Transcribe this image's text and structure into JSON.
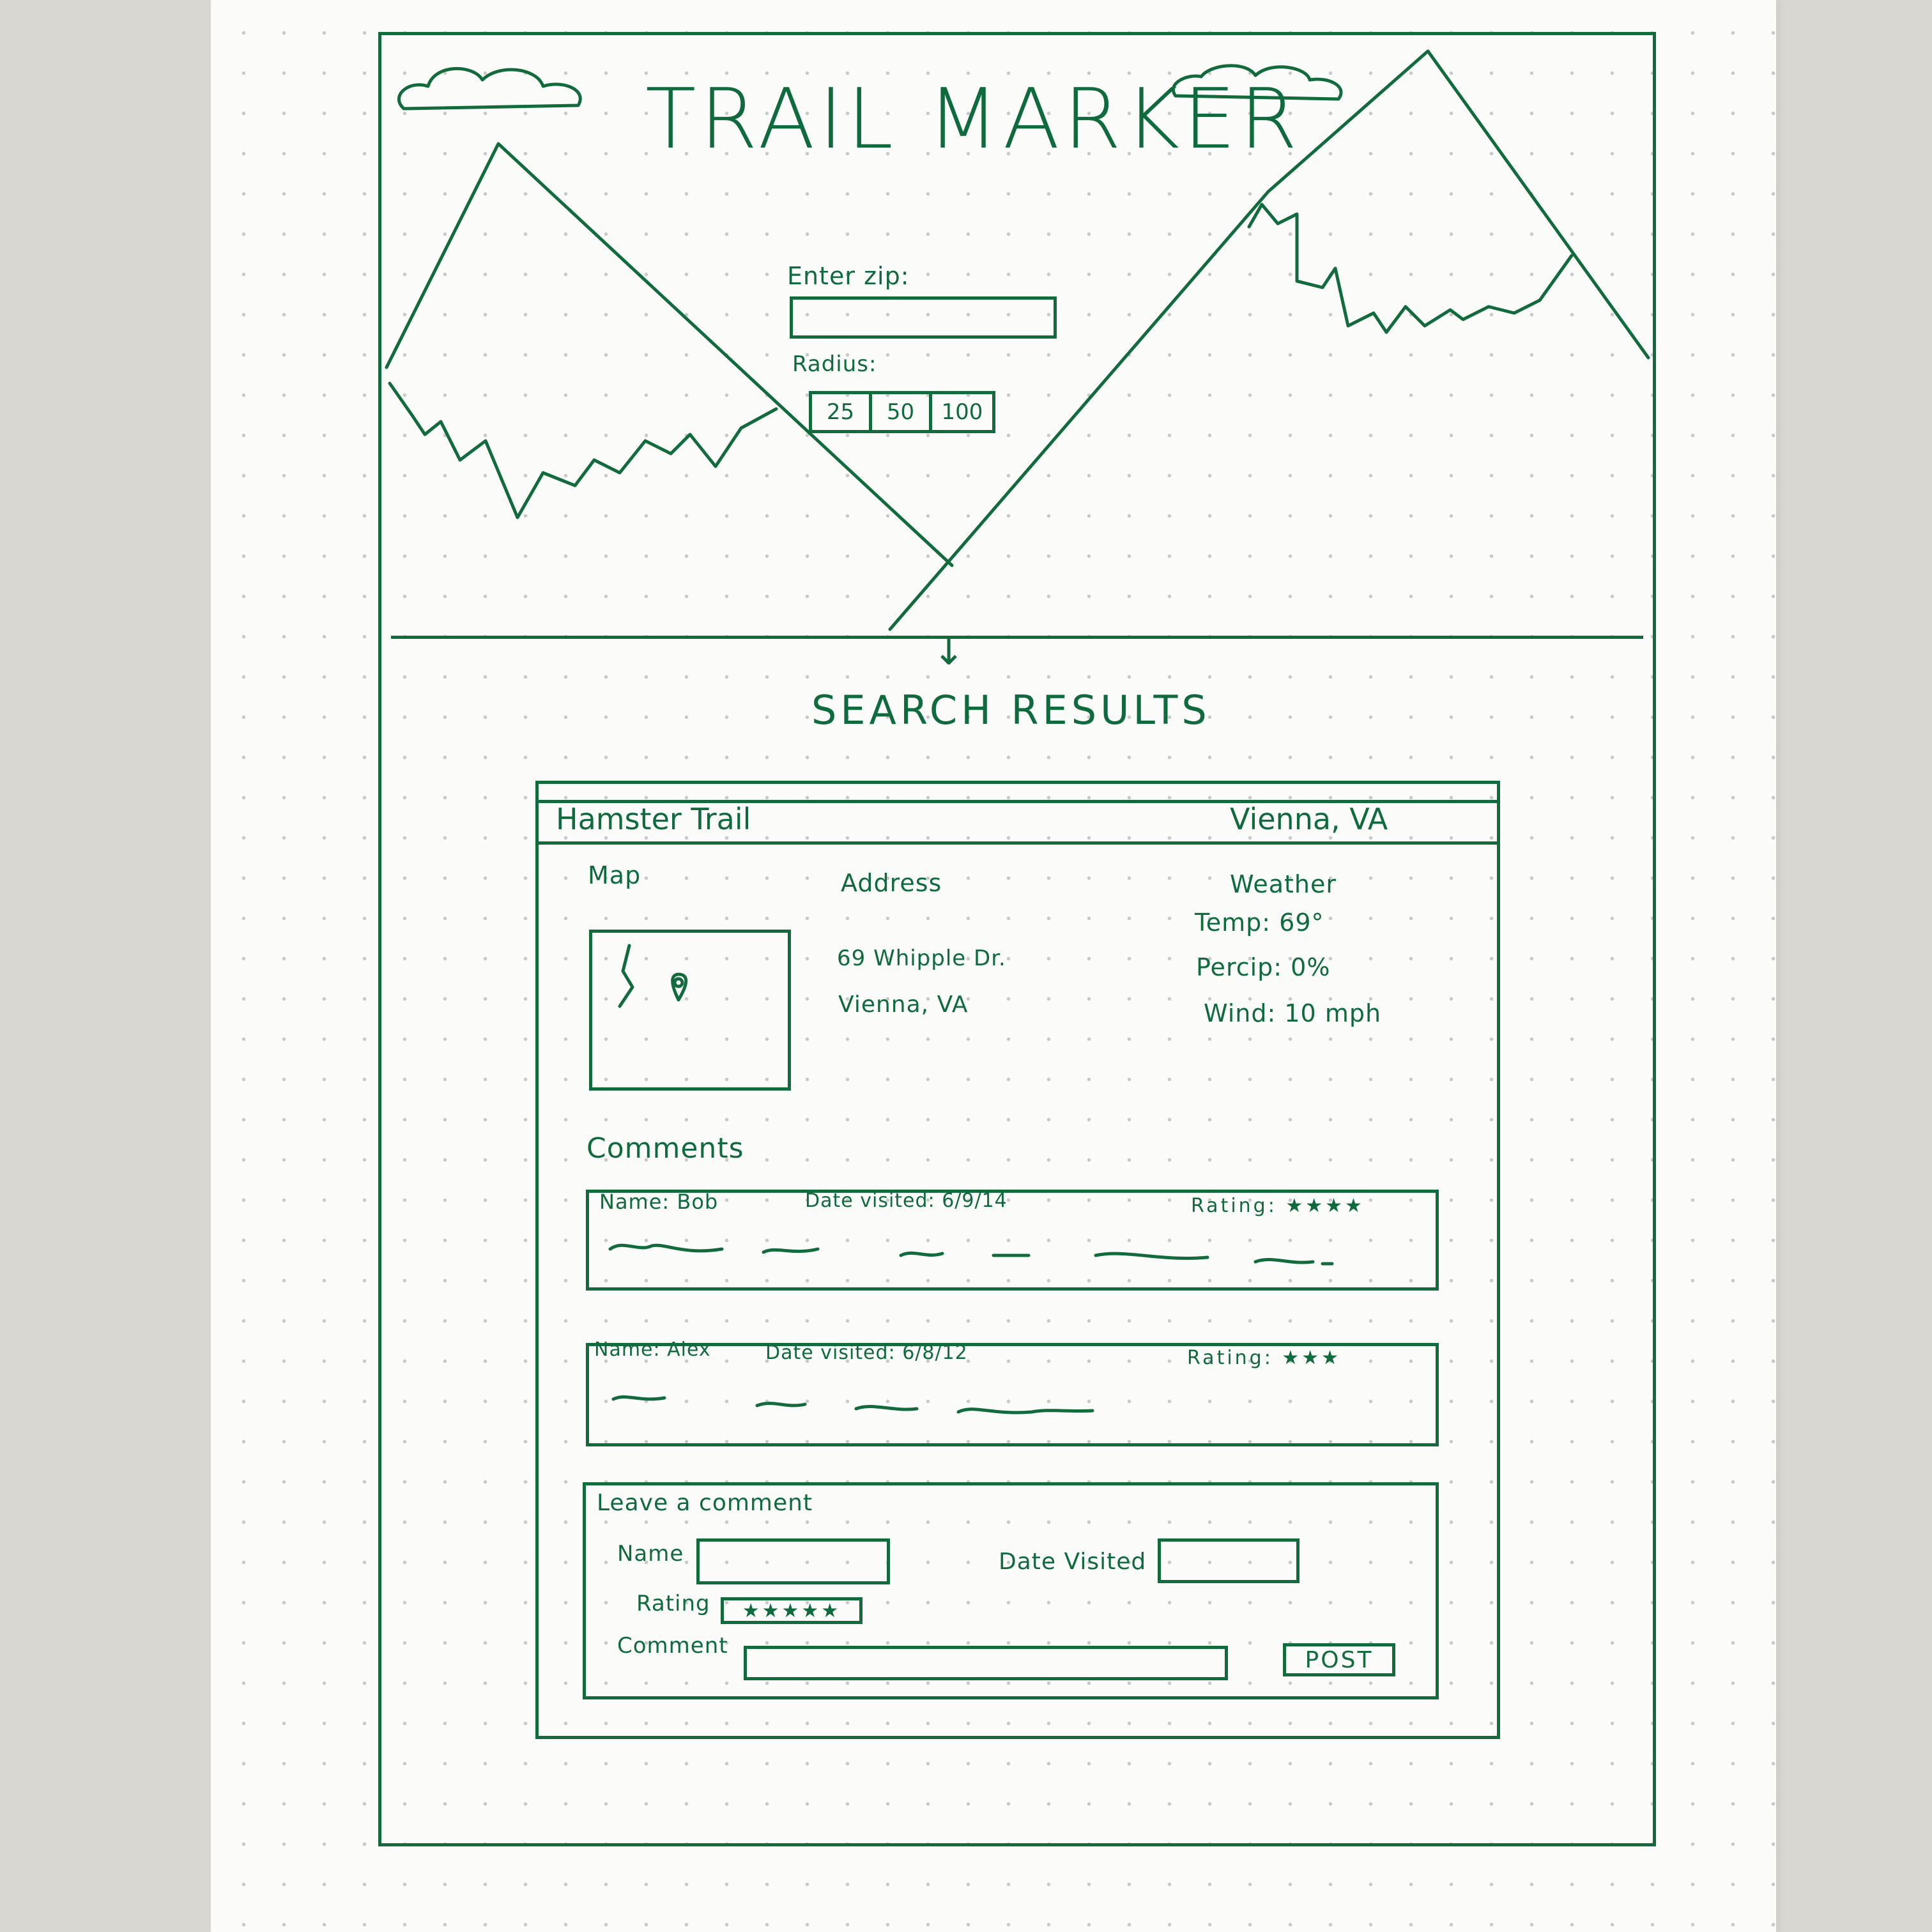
{
  "header": {
    "title": "TRAIL MARKER",
    "zip_label": "Enter zip:",
    "radius_label": "Radius:",
    "radius_options": [
      "25",
      "50",
      "100"
    ]
  },
  "results": {
    "title": "SEARCH RESULTS",
    "trail": {
      "name": "Hamster Trail",
      "location": "Vienna, VA",
      "map_label": "Map",
      "address_label": "Address",
      "address_line1": "69 Whipple Dr.",
      "address_line2": "Vienna, VA",
      "weather_label": "Weather",
      "temp": "Temp: 69°",
      "precip": "Percip: 0%",
      "wind": "Wind: 10 mph"
    },
    "comments_label": "Comments",
    "comments": [
      {
        "name": "Name: Bob",
        "date": "Date visited: 6/9/14",
        "rating": "Rating: ★★★★"
      },
      {
        "name": "Name: Alex",
        "date": "Date visited: 6/8/12",
        "rating": "Rating: ★★★"
      }
    ],
    "leave_comment": {
      "title": "Leave a comment",
      "name_label": "Name",
      "date_label": "Date Visited",
      "rating_label": "Rating",
      "rating_value": "★★★★★",
      "comment_label": "Comment",
      "post_label": "POST"
    }
  },
  "colors": {
    "ink": "#116b3c",
    "paper": "#fbfbfa",
    "background": "#d9d7d1"
  },
  "icons": [
    "arrow-down-icon",
    "map-pin-icon",
    "cloud-icon",
    "mountain-icon"
  ]
}
